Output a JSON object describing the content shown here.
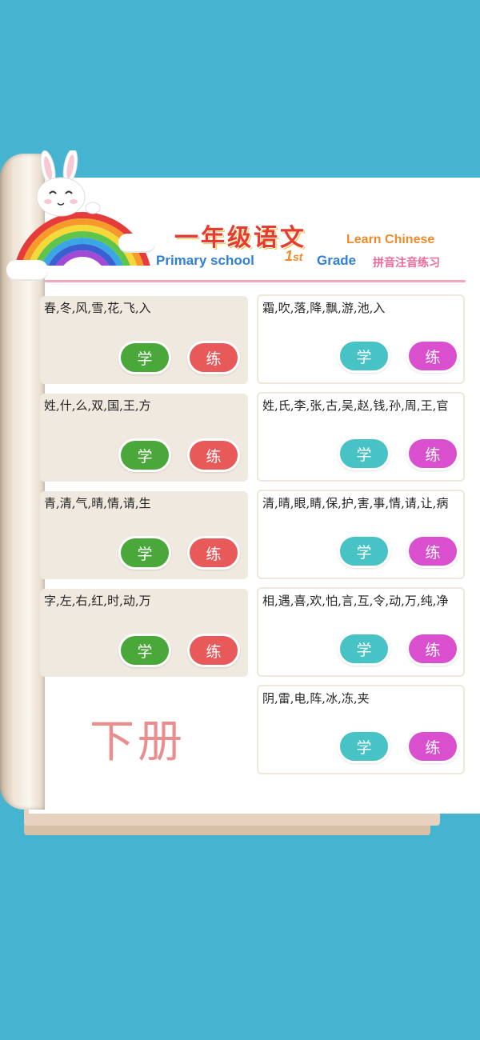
{
  "header": {
    "title_cn": "一年级语文",
    "title_en": "Learn Chinese",
    "subtitle_en": "Primary school",
    "grade_num": "1",
    "grade_suffix": "st",
    "grade_label": "Grade",
    "subtitle_cn": "拼音注音练习"
  },
  "buttons": {
    "learn": "学",
    "practice": "练"
  },
  "lessons_left": [
    {
      "text": "春,冬,风,雪,花,飞,入"
    },
    {
      "text": "姓,什,么,双,国,王,方"
    },
    {
      "text": "青,清,气,晴,情,请,生"
    },
    {
      "text": "字,左,右,红,时,动,万"
    }
  ],
  "lessons_right": [
    {
      "text": "霜,吹,落,降,飘,游,池,入"
    },
    {
      "text": "姓,氏,李,张,古,吴,赵,钱,孙,周,王,官"
    },
    {
      "text": "清,晴,眼,睛,保,护,害,事,情,请,让,病"
    },
    {
      "text": "相,遇,喜,欢,怕,言,互,令,动,万,纯,净"
    },
    {
      "text": "阴,雷,电,阵,冰,冻,夹"
    }
  ],
  "volume_label": "下册",
  "colors": {
    "background": "#44b4d0",
    "learn_left": "#4aa83a",
    "practice_left": "#e85a5a",
    "learn_right": "#47c2c5",
    "practice_right": "#d94fcd"
  }
}
